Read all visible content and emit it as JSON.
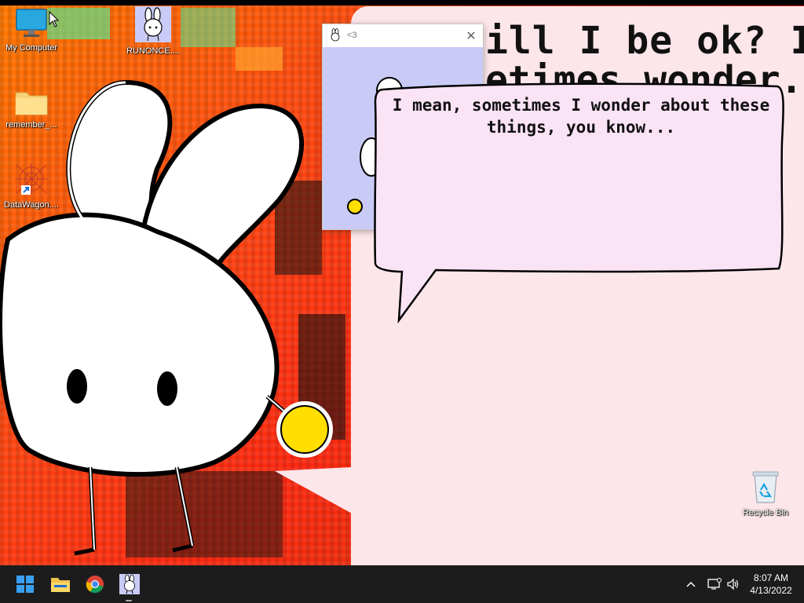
{
  "desktop": {
    "icons": [
      {
        "label": "My Computer",
        "icon": "monitor-icon"
      },
      {
        "label": "RUNONCE....",
        "icon": "bunny-icon"
      },
      {
        "label": "remember_...",
        "icon": "folder-icon"
      },
      {
        "label": "DataWagon....",
        "icon": "web-icon"
      },
      {
        "label": "Recycle Bin",
        "icon": "recycle-bin-icon"
      }
    ]
  },
  "background_panel": {
    "line1": "ill I be ok? I",
    "line2": "etimes wonder..."
  },
  "mini_window": {
    "title": "<3",
    "close_glyph": "✕"
  },
  "speech_bubble": {
    "text": "I mean, sometimes I wonder about these things, you know..."
  },
  "taskbar": {
    "apps": [
      {
        "name": "start",
        "icon": "windows-start-icon"
      },
      {
        "name": "file-explorer",
        "icon": "folder-icon"
      },
      {
        "name": "chrome",
        "icon": "chrome-icon"
      },
      {
        "name": "bunny-app",
        "icon": "bunny-icon"
      }
    ],
    "tray": {
      "chevron": "^",
      "time": "8:07 AM",
      "date": "4/13/2022"
    }
  },
  "colors": {
    "bubble_fill": "#fbe3f6",
    "panel_fill": "#fde6ea",
    "mini_window_fill": "#c9cbf6",
    "ball_yellow": "#ffde00"
  }
}
